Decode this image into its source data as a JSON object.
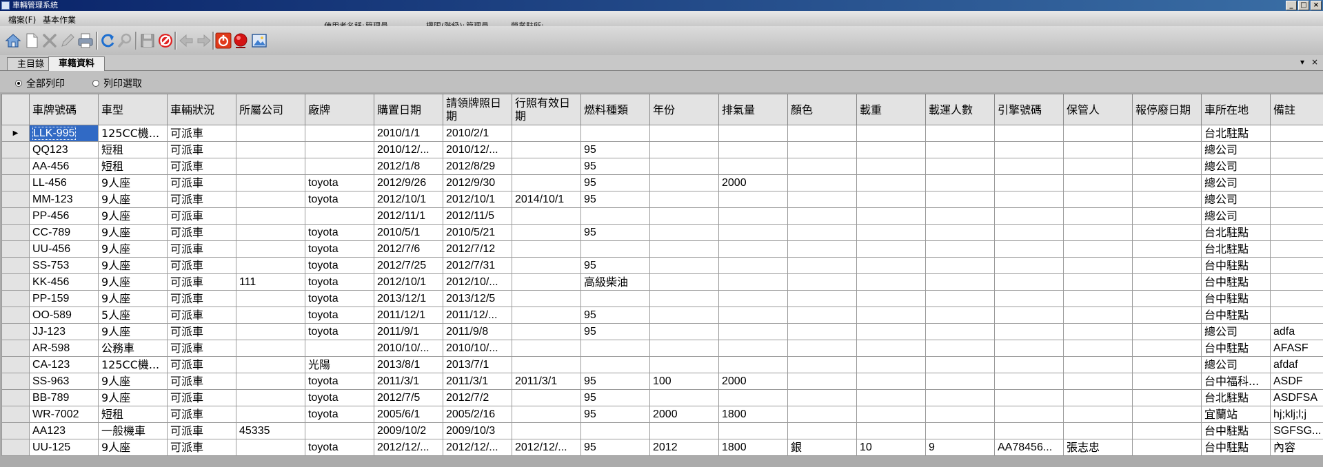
{
  "window": {
    "title": "車輛管理系統",
    "minimize": "_",
    "maximize": "□",
    "close": "×"
  },
  "menu": {
    "file": "檔案(F)",
    "basic": "基本作業"
  },
  "info": {
    "user_label": "使用者名稱:",
    "user_value": "管理員",
    "perm_label": "權限(階級):",
    "perm_value": "管理員",
    "site_label": "營業駐所:"
  },
  "toolbar": {
    "icons": [
      "home-icon",
      "new-document-icon",
      "delete-icon",
      "edit-icon",
      "print-icon",
      "refresh-icon",
      "search-icon",
      "save-icon",
      "stop-icon",
      "back-icon",
      "forward-icon",
      "power-icon",
      "alarm-icon",
      "image-icon"
    ]
  },
  "tabs": [
    {
      "label": "主目錄"
    },
    {
      "label": "車籍資料"
    }
  ],
  "tab_controls": {
    "dropdown": "▾",
    "close": "×"
  },
  "radios": {
    "print_all": "全部列印",
    "print_selected": "列印選取"
  },
  "grid": {
    "columns": [
      "車牌號碼",
      "車型",
      "車輛狀況",
      "所屬公司",
      "廠牌",
      "購置日期",
      "請領牌照日期",
      "行照有效日期",
      "燃料種類",
      "年份",
      "排氣量",
      "顏色",
      "載重",
      "載運人數",
      "引擎號碼",
      "保管人",
      "報停廢日期",
      "車所在地",
      "備註"
    ],
    "rows": [
      [
        "LLK-995",
        "125CC機...",
        "可派車",
        "",
        "",
        "2010/1/1",
        "2010/2/1",
        "",
        "",
        "",
        "",
        "",
        "",
        "",
        "",
        "",
        "",
        "台北駐點",
        ""
      ],
      [
        "QQ123",
        "短租",
        "可派車",
        "",
        "",
        "2010/12/...",
        "2010/12/...",
        "",
        "95",
        "",
        "",
        "",
        "",
        "",
        "",
        "",
        "",
        "總公司",
        ""
      ],
      [
        "AA-456",
        "短租",
        "可派車",
        "",
        "",
        "2012/1/8",
        "2012/8/29",
        "",
        "95",
        "",
        "",
        "",
        "",
        "",
        "",
        "",
        "",
        "總公司",
        ""
      ],
      [
        "LL-456",
        "9人座",
        "可派車",
        "",
        "toyota",
        "2012/9/26",
        "2012/9/30",
        "",
        "95",
        "",
        "2000",
        "",
        "",
        "",
        "",
        "",
        "",
        "總公司",
        ""
      ],
      [
        "MM-123",
        "9人座",
        "可派車",
        "",
        "toyota",
        "2012/10/1",
        "2012/10/1",
        "2014/10/1",
        "95",
        "",
        "",
        "",
        "",
        "",
        "",
        "",
        "",
        "總公司",
        ""
      ],
      [
        "PP-456",
        "9人座",
        "可派車",
        "",
        "",
        "2012/11/1",
        "2012/11/5",
        "",
        "",
        "",
        "",
        "",
        "",
        "",
        "",
        "",
        "",
        "總公司",
        ""
      ],
      [
        "CC-789",
        "9人座",
        "可派車",
        "",
        "toyota",
        "2010/5/1",
        "2010/5/21",
        "",
        "95",
        "",
        "",
        "",
        "",
        "",
        "",
        "",
        "",
        "台北駐點",
        ""
      ],
      [
        "UU-456",
        "9人座",
        "可派車",
        "",
        "toyota",
        "2012/7/6",
        "2012/7/12",
        "",
        "",
        "",
        "",
        "",
        "",
        "",
        "",
        "",
        "",
        "台北駐點",
        ""
      ],
      [
        "SS-753",
        "9人座",
        "可派車",
        "",
        "toyota",
        "2012/7/25",
        "2012/7/31",
        "",
        "95",
        "",
        "",
        "",
        "",
        "",
        "",
        "",
        "",
        "台中駐點",
        ""
      ],
      [
        "KK-456",
        "9人座",
        "可派車",
        "111",
        "toyota",
        "2012/10/1",
        "2012/10/...",
        "",
        "高級柴油",
        "",
        "",
        "",
        "",
        "",
        "",
        "",
        "",
        "台中駐點",
        ""
      ],
      [
        "PP-159",
        "9人座",
        "可派車",
        "",
        "toyota",
        "2013/12/1",
        "2013/12/5",
        "",
        "",
        "",
        "",
        "",
        "",
        "",
        "",
        "",
        "",
        "台中駐點",
        ""
      ],
      [
        "OO-589",
        "5人座",
        "可派車",
        "",
        "toyota",
        "2011/12/1",
        "2011/12/...",
        "",
        "95",
        "",
        "",
        "",
        "",
        "",
        "",
        "",
        "",
        "台中駐點",
        ""
      ],
      [
        "JJ-123",
        "9人座",
        "可派車",
        "",
        "toyota",
        "2011/9/1",
        "2011/9/8",
        "",
        "95",
        "",
        "",
        "",
        "",
        "",
        "",
        "",
        "",
        "總公司",
        "adfa"
      ],
      [
        "AR-598",
        "公務車",
        "可派車",
        "",
        "",
        "2010/10/...",
        "2010/10/...",
        "",
        "",
        "",
        "",
        "",
        "",
        "",
        "",
        "",
        "",
        "台中駐點",
        "AFASF"
      ],
      [
        "CA-123",
        "125CC機...",
        "可派車",
        "",
        "光陽",
        "2013/8/1",
        "2013/7/1",
        "",
        "",
        "",
        "",
        "",
        "",
        "",
        "",
        "",
        "",
        "總公司",
        "afdaf"
      ],
      [
        "SS-963",
        "9人座",
        "可派車",
        "",
        "toyota",
        "2011/3/1",
        "2011/3/1",
        "2011/3/1",
        "95",
        "100",
        "2000",
        "",
        "",
        "",
        "",
        "",
        "",
        "台中福科...",
        "ASDF"
      ],
      [
        "BB-789",
        "9人座",
        "可派車",
        "",
        "toyota",
        "2012/7/5",
        "2012/7/2",
        "",
        "95",
        "",
        "",
        "",
        "",
        "",
        "",
        "",
        "",
        "台北駐點",
        "ASDFSA"
      ],
      [
        "WR-7002",
        "短租",
        "可派車",
        "",
        "toyota",
        "2005/6/1",
        "2005/2/16",
        "",
        "95",
        "2000",
        "1800",
        "",
        "",
        "",
        "",
        "",
        "",
        "宜蘭站",
        "hj;klj;l;j"
      ],
      [
        "AA123",
        "一般機車",
        "可派車",
        "45335",
        "",
        "2009/10/2",
        "2009/10/3",
        "",
        "",
        "",
        "",
        "",
        "",
        "",
        "",
        "",
        "",
        "台中駐點",
        "SGFSG..."
      ],
      [
        "UU-125",
        "9人座",
        "可派車",
        "",
        "toyota",
        "2012/12/...",
        "2012/12/...",
        "2012/12/...",
        "95",
        "2012",
        "1800",
        "銀",
        "10",
        "9",
        "AA78456...",
        "張志忠",
        "",
        "台中駐點",
        "內容"
      ]
    ]
  }
}
